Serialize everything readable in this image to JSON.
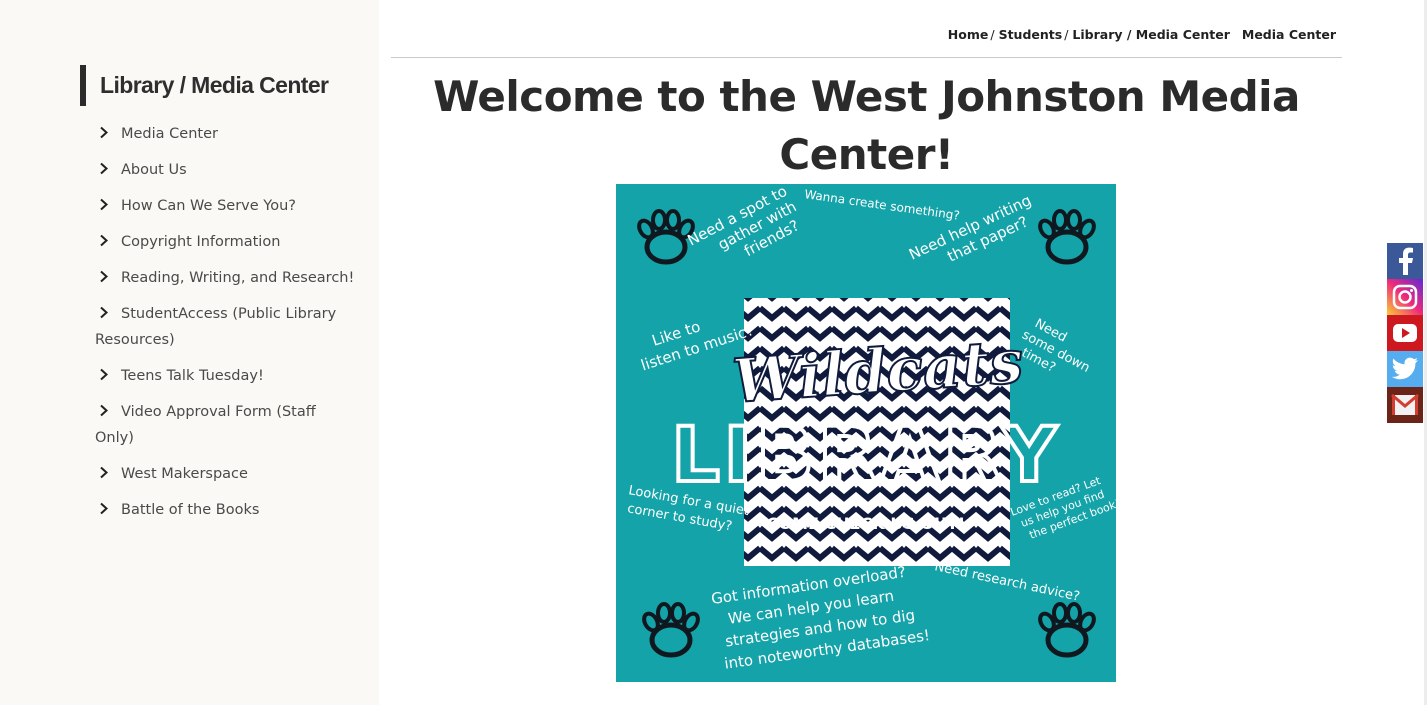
{
  "sidebar": {
    "title": "Library / Media Center",
    "items": [
      {
        "label": "Media Center"
      },
      {
        "label": "About Us"
      },
      {
        "label": "How Can We Serve You?"
      },
      {
        "label": "Copyright Information"
      },
      {
        "label": "Reading, Writing, and Research!"
      },
      {
        "label": "StudentAccess (Public Library Resources)"
      },
      {
        "label": "Teens Talk Tuesday!"
      },
      {
        "label": "Video Approval Form (Staff Only)"
      },
      {
        "label": "West Makerspace"
      },
      {
        "label": "Battle of the Books"
      }
    ],
    "chevron_icon": "chevron-right-icon"
  },
  "breadcrumb": {
    "home": "Home",
    "students": "Students",
    "library": "Library / Media Center",
    "current": "Media Center",
    "separator": "/"
  },
  "main": {
    "title": "Welcome to the West Johnston Media Center!"
  },
  "poster": {
    "background": "#14a3a8",
    "questions": [
      "Need a spot to gather with friends?",
      "Wanna create something?",
      "Need help writing that paper?",
      "Like to listen to music?",
      "Need some down time?",
      "Looking for a quiet corner to study?",
      "Love to read? Let us help you find the perfect book!",
      "Need research advice?",
      "Got information overload? We can help you learn strategies and how to dig into noteworthy databases!"
    ],
    "script_title": "Wildcats",
    "block_title": "LIBRARY",
    "cta": "COME CHECK US OUT!",
    "icon": "paw-print-icon"
  },
  "social": [
    {
      "name": "facebook-icon",
      "color": "#3b5998"
    },
    {
      "name": "instagram-icon",
      "color": "#d6249f"
    },
    {
      "name": "youtube-icon",
      "color": "#cc181e"
    },
    {
      "name": "twitter-icon",
      "color": "#55acee"
    },
    {
      "name": "email-icon",
      "color": "#6b2417"
    }
  ]
}
